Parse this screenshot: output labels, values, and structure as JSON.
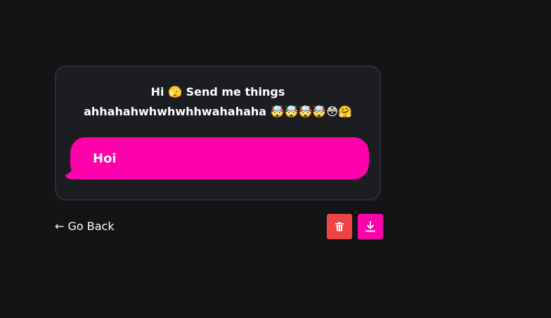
{
  "card": {
    "prompt": "Hi 🫣 Send me things\nahhahahwhwhwhhwahahaha 🤯🤯🤯🤯😳🤗",
    "message": "Hoi"
  },
  "footer": {
    "back_label": "← Go Back",
    "delete_icon": "trash-icon",
    "download_icon": "download-icon"
  },
  "colors": {
    "background": "#141417",
    "card": "#1c1d21",
    "accent": "#ff00aa",
    "danger": "#ef4444"
  }
}
